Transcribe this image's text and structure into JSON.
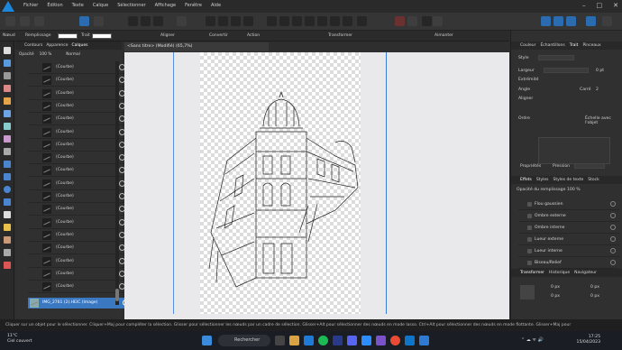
{
  "menu": {
    "items": [
      "Fichier",
      "Édition",
      "Texte",
      "Calque",
      "Sélectionner",
      "Affichage",
      "Fenêtre",
      "Aide"
    ]
  },
  "context_bar": {
    "persona": "Nœud",
    "fill_label": "Remplissage",
    "stroke_label": "Trait",
    "align_label": "Aligner",
    "convert_label": "Convertir",
    "action_label": "Action",
    "transform_label": "Transformer",
    "snap_label": "Aimanter",
    "show_transform_label": "Afficher l'orientation"
  },
  "layers_panel": {
    "tabs": [
      "Contours",
      "Apparence",
      "Calques"
    ],
    "active_tab": "Calques",
    "opacity_label": "Opacité",
    "opacity_value": "100 %",
    "blend_mode": "Normal",
    "items": [
      "(Courbe)",
      "(Courbe)",
      "(Courbe)",
      "(Courbe)",
      "(Courbe)",
      "(Courbe)",
      "(Courbe)",
      "(Courbe)",
      "(Courbe)",
      "(Courbe)",
      "(Courbe)",
      "(Courbe)",
      "(Courbe)",
      "(Courbe)",
      "(Courbe)",
      "(Courbe)",
      "(Courbe)",
      "(Courbe)"
    ],
    "image_layer": "IMG_2761 (2).HEIC (Image)"
  },
  "document": {
    "tab_title": "<Sans titre> (Modifié) (65,7%)"
  },
  "right_panel": {
    "tabs_top": [
      "Couleur",
      "Échantillons",
      "Trait",
      "Pinceaux"
    ],
    "active_top": "Trait",
    "style_label": "Style",
    "width_label": "Largeur",
    "width_value": "0 pt",
    "ends_label": "Extrémité",
    "angle_label": "Angle",
    "angle_value": "Carré",
    "angle_num": "2",
    "align_label": "Aligner",
    "order_label": "Ordre",
    "scale_label": "Échelle avec l'objet",
    "pressure_label": "Propriétés",
    "pressure_value": "Pression",
    "tabs_mid": [
      "Effets",
      "Styles",
      "Styles de texte",
      "Stock"
    ],
    "active_mid": "Effets",
    "blend_label": "Opacité du remplissage",
    "blend_value": "100 %",
    "effects": [
      "Flou gaussien",
      "Ombre externe",
      "Ombre interne",
      "Lueur externe",
      "Lueur interne",
      "Biseau/Relief"
    ],
    "tabs_bottom": [
      "Transformer",
      "Historique",
      "Navigateur"
    ],
    "active_bottom": "Transformer",
    "tf_values": [
      "0 px",
      "0 px",
      "0 px",
      "0 px"
    ]
  },
  "status_bar": {
    "text": "Cliquer sur un objet pour le sélectionner. Cliquer+Maj pour compléter la sélection. Glisser pour sélectionner les nœuds par un cadre de sélection. Glisser+Alt pour sélectionner des nœuds en mode lasso. Ctrl+Alt pour sélectionner des nœuds en mode flottante. Glisser+Maj pour"
  },
  "taskbar": {
    "weather_temp": "11°C",
    "weather_desc": "Ciel couvert",
    "search_placeholder": "Rechercher",
    "time": "17:25",
    "date": "15/04/2023"
  },
  "colors": {
    "accent": "#2b6cb0",
    "selected_layer": "#3b78c2",
    "canvas": "#e9e9ec"
  }
}
